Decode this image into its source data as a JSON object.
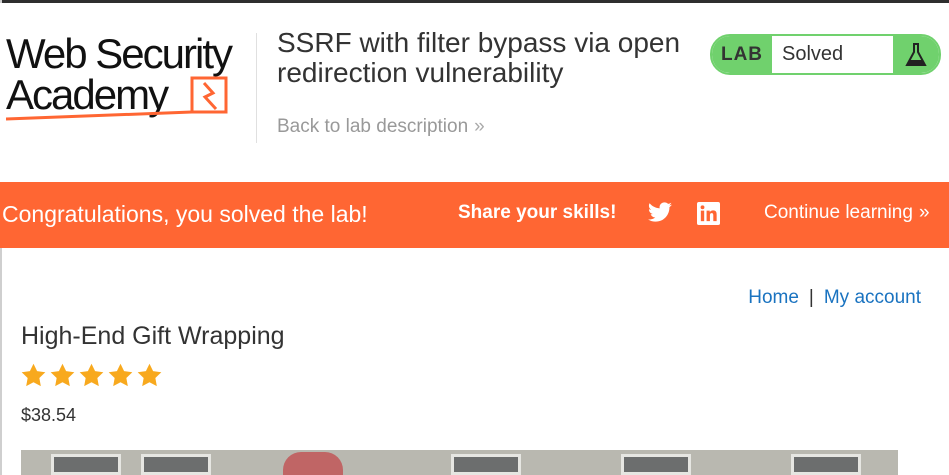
{
  "logo": {
    "line1": "Web Security",
    "line2": "Academy"
  },
  "lab": {
    "title": "SSRF with filter bypass via open redirection vulnerability",
    "back_link": "Back to lab description",
    "status_label": "LAB",
    "status_value": "Solved"
  },
  "banner": {
    "message": "Congratulations, you solved the lab!",
    "share": "Share your skills!",
    "continue": "Continue learning"
  },
  "nav": {
    "home": "Home",
    "separator": "|",
    "account": "My account"
  },
  "product": {
    "title": "High-End Gift Wrapping",
    "rating": 5,
    "price": "$38.54"
  },
  "colors": {
    "accent_orange": "#ff6633",
    "status_green": "#70d16d",
    "link_blue": "#1a73c0",
    "star_gold": "#f8a91e"
  },
  "icons": [
    "lightning-bolt-icon",
    "flask-icon",
    "chevron-right-icon",
    "twitter-icon",
    "linkedin-icon",
    "star-icon"
  ]
}
